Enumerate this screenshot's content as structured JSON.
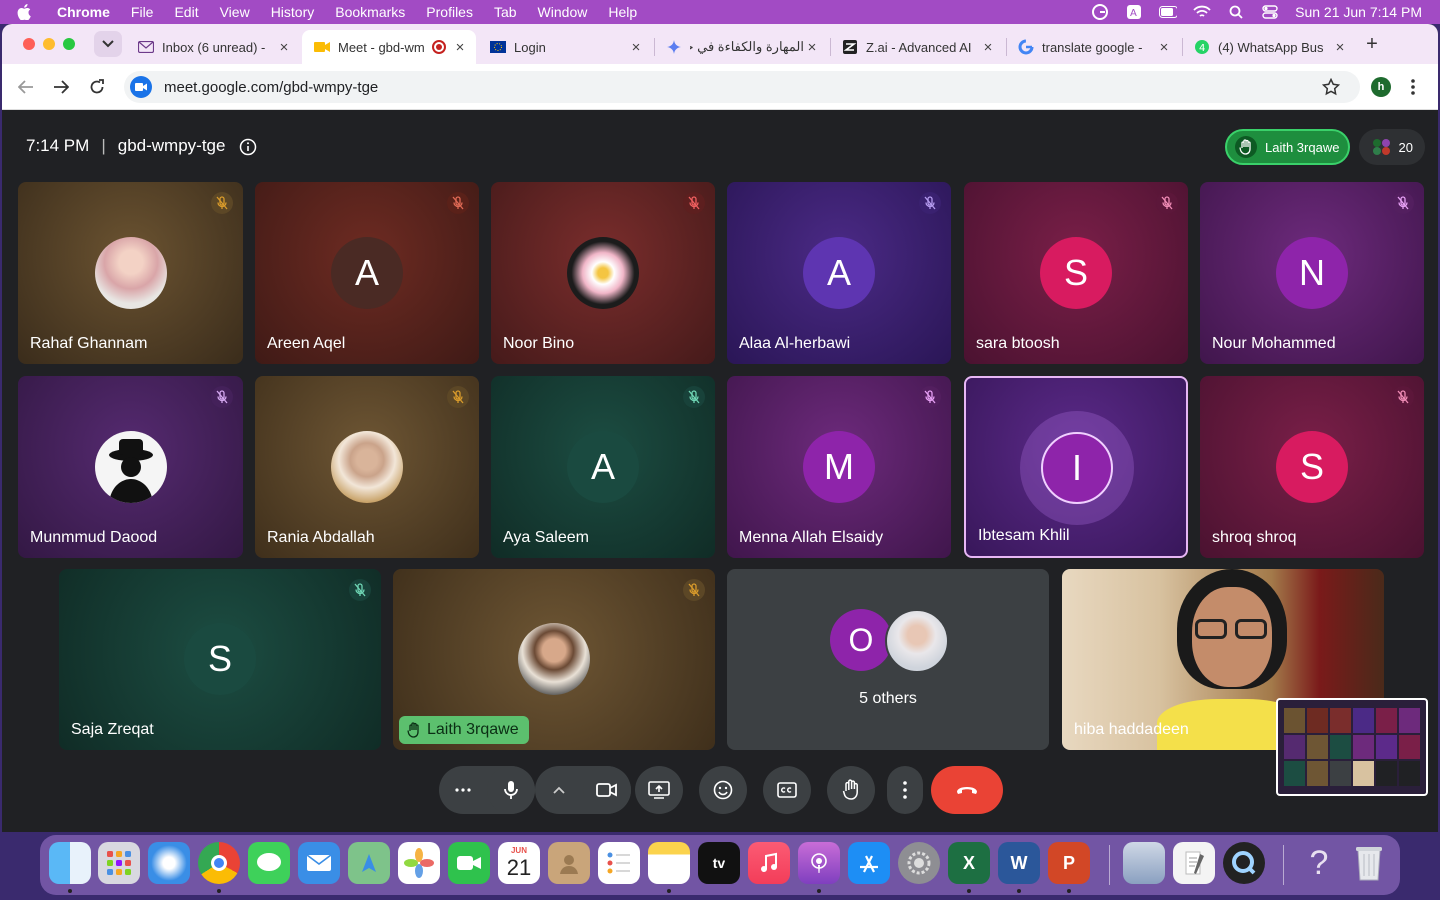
{
  "menubar": {
    "app": "Chrome",
    "items": [
      "File",
      "Edit",
      "View",
      "History",
      "Bookmarks",
      "Profiles",
      "Tab",
      "Window",
      "Help"
    ],
    "clock": "Sun 21 Jun  7:14 PM"
  },
  "tabs": [
    {
      "title": "Inbox (6 unread) -",
      "icon": "mail-icon"
    },
    {
      "title": "Meet - gbd-wm",
      "icon": "meet-icon",
      "active": true
    },
    {
      "title": "Login",
      "icon": "eu-flag-icon"
    },
    {
      "title": "المهارة والكفاءة في حر",
      "icon": "gemini-icon"
    },
    {
      "title": "Z.ai - Advanced AI",
      "icon": "zai-icon"
    },
    {
      "title": "translate google -",
      "icon": "google-icon"
    },
    {
      "title": "(4) WhatsApp Bus",
      "icon": "whatsapp-icon"
    }
  ],
  "address_bar": {
    "url": "meet.google.com/gbd-wmpy-tge"
  },
  "profile_initial": "h",
  "meet": {
    "time": "7:14 PM",
    "separator": "|",
    "code": "gbd-wmpy-tge",
    "raised_hand_name": "Laith 3rqawe",
    "participant_count": "20",
    "participants": [
      {
        "name": "Rahaf Ghannam",
        "initial": "",
        "photo": true
      },
      {
        "name": "Areen Aqel",
        "initial": "A"
      },
      {
        "name": "Noor Bino",
        "initial": "",
        "photo": true
      },
      {
        "name": "Alaa Al-herbawi",
        "initial": "A"
      },
      {
        "name": "sara btoosh",
        "initial": "S"
      },
      {
        "name": "Nour Mohammed",
        "initial": "N"
      },
      {
        "name": "Munmmud Daood",
        "initial": "",
        "photo": true
      },
      {
        "name": "Rania Abdallah",
        "initial": "",
        "photo": true
      },
      {
        "name": "Aya Saleem",
        "initial": "A"
      },
      {
        "name": "Menna Allah Elsaidy",
        "initial": "M"
      },
      {
        "name": "Ibtesam Khlil",
        "initial": "I",
        "speaking": true
      },
      {
        "name": "shroq shroq",
        "initial": "S"
      },
      {
        "name": "Saja Zreqat",
        "initial": "S"
      },
      {
        "name": "Laith 3rqawe",
        "initial": "",
        "photo": true,
        "hand_raised": true
      }
    ],
    "others": {
      "label": "5 others",
      "initial": "O"
    },
    "video_tile": {
      "name": "hiba haddadeen"
    }
  },
  "colors": {
    "accent": "#a24bc4",
    "meet_bg": "#202124",
    "end_call": "#ea4335",
    "hand_green": "#1e8e3e"
  },
  "dock_icons": [
    "finder-icon",
    "launchpad-icon",
    "safari-icon",
    "chrome-icon",
    "messages-icon",
    "mail-icon",
    "maps-icon",
    "photos-icon",
    "facetime-icon",
    "calendar-icon",
    "contacts-icon",
    "reminders-icon",
    "notes-icon",
    "appletv-icon",
    "music-icon",
    "podcasts-icon",
    "appstore-icon",
    "settings-icon",
    "excel-icon",
    "word-icon",
    "powerpoint-icon",
    "preview-icon",
    "textedit-icon",
    "quicktime-icon",
    "help-icon",
    "trash-icon"
  ],
  "calendar": {
    "month": "JUN",
    "day": "21"
  }
}
